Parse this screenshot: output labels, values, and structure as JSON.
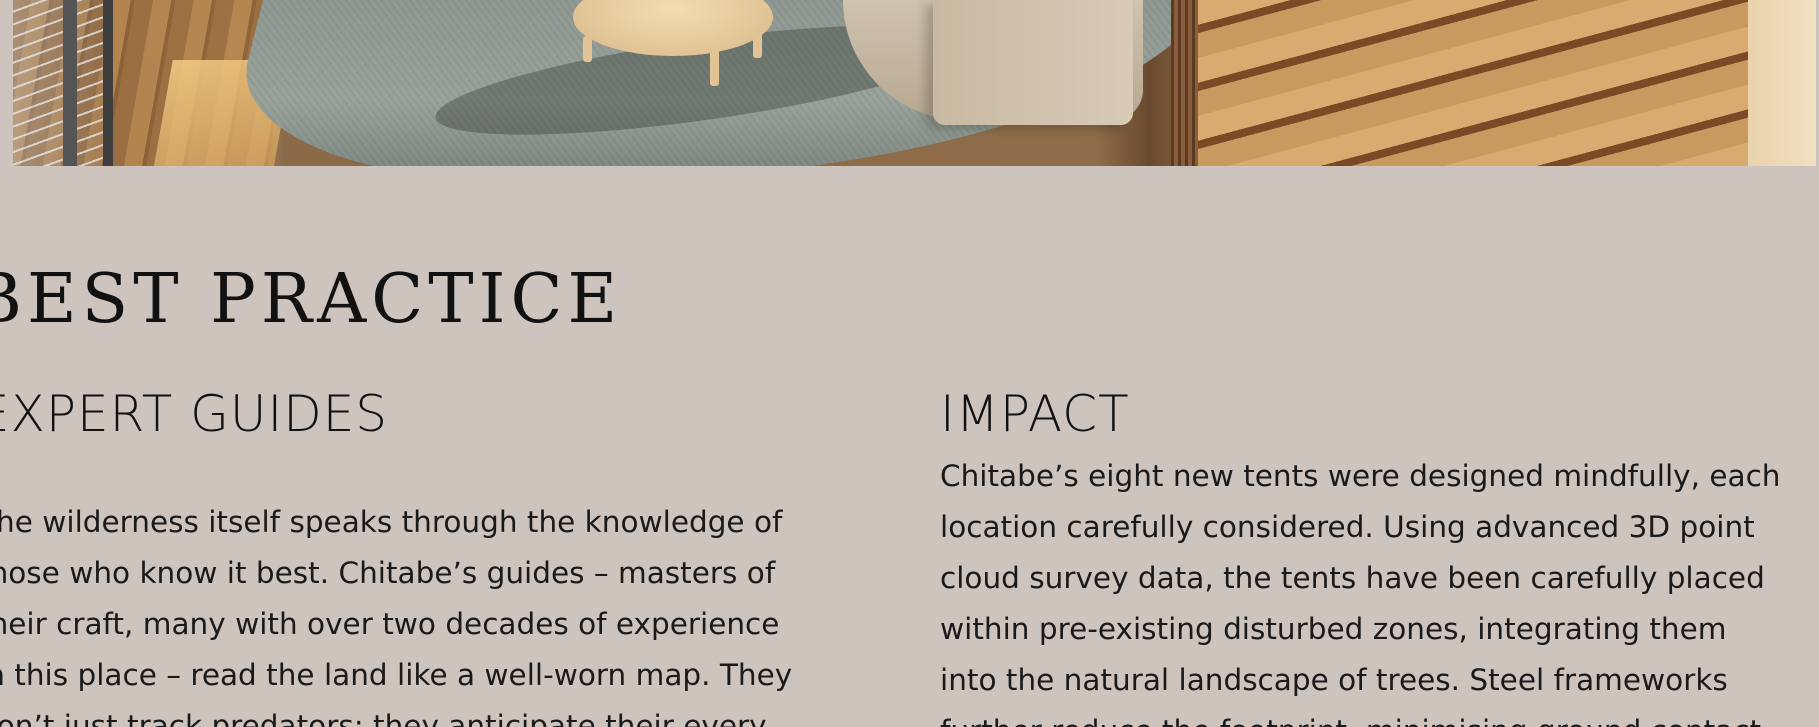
{
  "hero": {
    "alt": "Lodge interior with curved sofa, round coffee table, rug and wooden stairs"
  },
  "section": {
    "title": "BEST PRACTICE"
  },
  "left_column": {
    "heading": "EXPERT GUIDES",
    "lines": [
      "The wilderness itself speaks through the knowledge of",
      "those who know it best. Chitabe’s guides – masters of",
      "their craft, many with over two decades of experience",
      "in this place – read the land like a well-worn map. They",
      "don’t just track predators; they anticipate their every"
    ]
  },
  "right_column": {
    "heading": "IMPACT",
    "lines": [
      "Chitabe’s eight new tents were designed mindfully, each",
      "location carefully considered. Using advanced 3D point",
      "cloud survey data, the tents have been carefully placed",
      "within pre-existing disturbed zones, integrating them",
      "into the natural landscape of trees. Steel frameworks",
      "further reduce the footprint, minimising ground contact"
    ]
  }
}
